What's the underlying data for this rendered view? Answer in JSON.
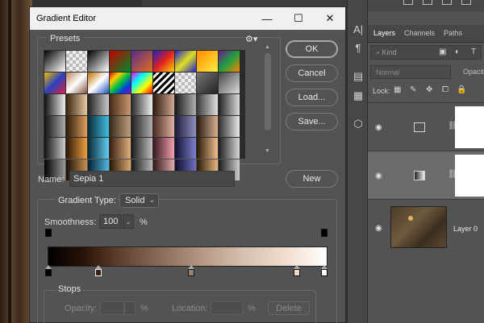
{
  "dialog": {
    "title": "Gradient Editor",
    "presets_label": "Presets",
    "name_label": "Name:",
    "name_value": "Sepia 1",
    "buttons": {
      "ok": "OK",
      "cancel": "Cancel",
      "load": "Load...",
      "save": "Save...",
      "new": "New"
    },
    "gradient_type_label": "Gradient Type:",
    "gradient_type_value": "Solid",
    "smoothness_label": "Smoothness:",
    "smoothness_value": "100",
    "percent": "%",
    "stops": {
      "label": "Stops",
      "opacity_label": "Opacity:",
      "location_label": "Location:",
      "delete_label": "Delete"
    }
  },
  "panel": {
    "tabs": [
      "Layers",
      "Channels",
      "Paths"
    ],
    "kind_placeholder": "Kind",
    "blend_mode": "Normal",
    "opacity_label": "Opacit",
    "lock_label": "Lock:",
    "layers": [
      {
        "name": ""
      },
      {
        "name": ""
      },
      {
        "name": "Layer 0"
      }
    ]
  }
}
